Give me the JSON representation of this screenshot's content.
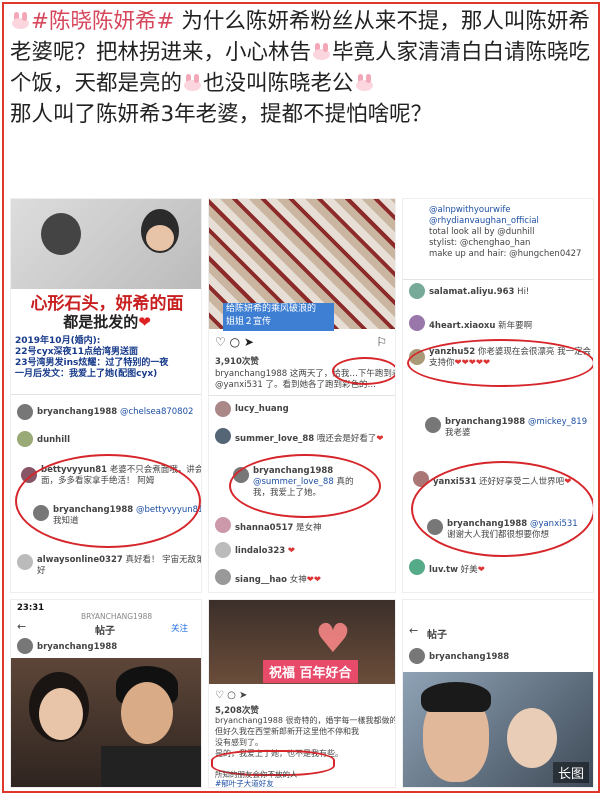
{
  "post": {
    "tag": "#陈晓陈妍希#",
    "text1": " 为什么陈妍希粉丝从来不提，那人叫陈妍希老婆呢？把林拐进来，小心林告",
    "text2": "毕竟人家清清白白请陈晓吃个饭，天都是亮的",
    "text3": "也没叫陈晓老公",
    "text4": "那人叫了陈妍希3年老婆，提都不提怕啥呢？"
  },
  "c1": {
    "title1": "心形石头，妍希的面",
    "title2": "都是批发的",
    "l1": "2019年10月(婚内):",
    "l2": "22号cyx深夜11点给湾男送面",
    "l3": "23号湾男发ins炫耀：过了特别的一夜",
    "l4": "一月后发文：我爱上了她(配图cyx)",
    "user1": "bryanchang1988",
    "reply1": "@chelsea870802",
    "user2": "dunhill",
    "user3": "bettyvyyun81",
    "c3": "老婆不只会煮面哦，讲会煮",
    "c3b": "面，多多看家拿手绝活！ 阿姆",
    "user4": "bryanchang1988",
    "reply4": "@bettyvyyun81",
    "c4": "我知道",
    "user5": "alwaysonline0327",
    "c5": "真好看！ 宇宙无敌第一",
    "c5b": "好"
  },
  "c2": {
    "caption1": "给陈妍希的乘风破浪的",
    "caption2": "姐姐２宣传",
    "likes": "3,910次赞",
    "desc": "bryanchang1988 这两天了，给我…下午跑到老婆",
    "desc2": "@yanxi531 了。看到她各了跑到彩色的…",
    "mark": "下午跑到老婆",
    "user1": "lucy_huang",
    "user2": "summer_love_88",
    "c2": "哦还会是好看了",
    "user3": "bryanchang1988",
    "reply3": "@summer_love_88",
    "c3": "真的",
    "c3b": "我，我爱上了她。",
    "user4": "shanna0517",
    "c4": "是女神",
    "user5": "lindalo323",
    "user6": "siang__hao",
    "c6": "女神"
  },
  "c3": {
    "t1": "@alnpwithyourwife",
    "t2": "@rhydianvaughan_official",
    "t3": "total look all by @dunhill",
    "t4": "stylist: @chenghao_han",
    "t5": "make up and hair: @hungchen0427",
    "user1": "salamat.aliyu.963",
    "c1": "Hi!",
    "user2": "4heart.xiaoxu",
    "c2": "新年要啊",
    "user3": "yanzhu52",
    "c3": "你老婆现在会很漂亮 我一定会",
    "c3b": "支持你",
    "user4": "bryanchang1988",
    "reply4": "@mickey_819",
    "c4": "我老婆",
    "user5": "yanxi531",
    "c5": "还好好享受二人世界吧",
    "user6": "bryanchang1988",
    "reply6": "@yanxi531",
    "c6": "谢谢大人我们都很想要你想",
    "user7": "luv.tw",
    "c7": "好美"
  },
  "c4": {
    "time": "23:31",
    "account": "BRYANCHANG1988",
    "title": "帖子",
    "follow": "关注",
    "user": "bryanchang1988"
  },
  "c5": {
    "banner": "祝福 百年好合",
    "likes": "5,208次赞",
    "desc1": "bryanchang1988 很奇特的，婚宇每一樣我都做的很完",
    "desc2": "但好久我在西堂新郎新开这里他不停和我",
    "desc3": "没有感到了。",
    "desc4": "是的，我爱上了她，也不是我有些。",
    "tags1": "所知的朋友会你不放的人",
    "tags2": "#郁叶子大道好友",
    "tags3": "#新你来爱去旅行"
  },
  "c6": {
    "title": "帖子",
    "user": "bryanchang1988",
    "watermark": "长图"
  }
}
